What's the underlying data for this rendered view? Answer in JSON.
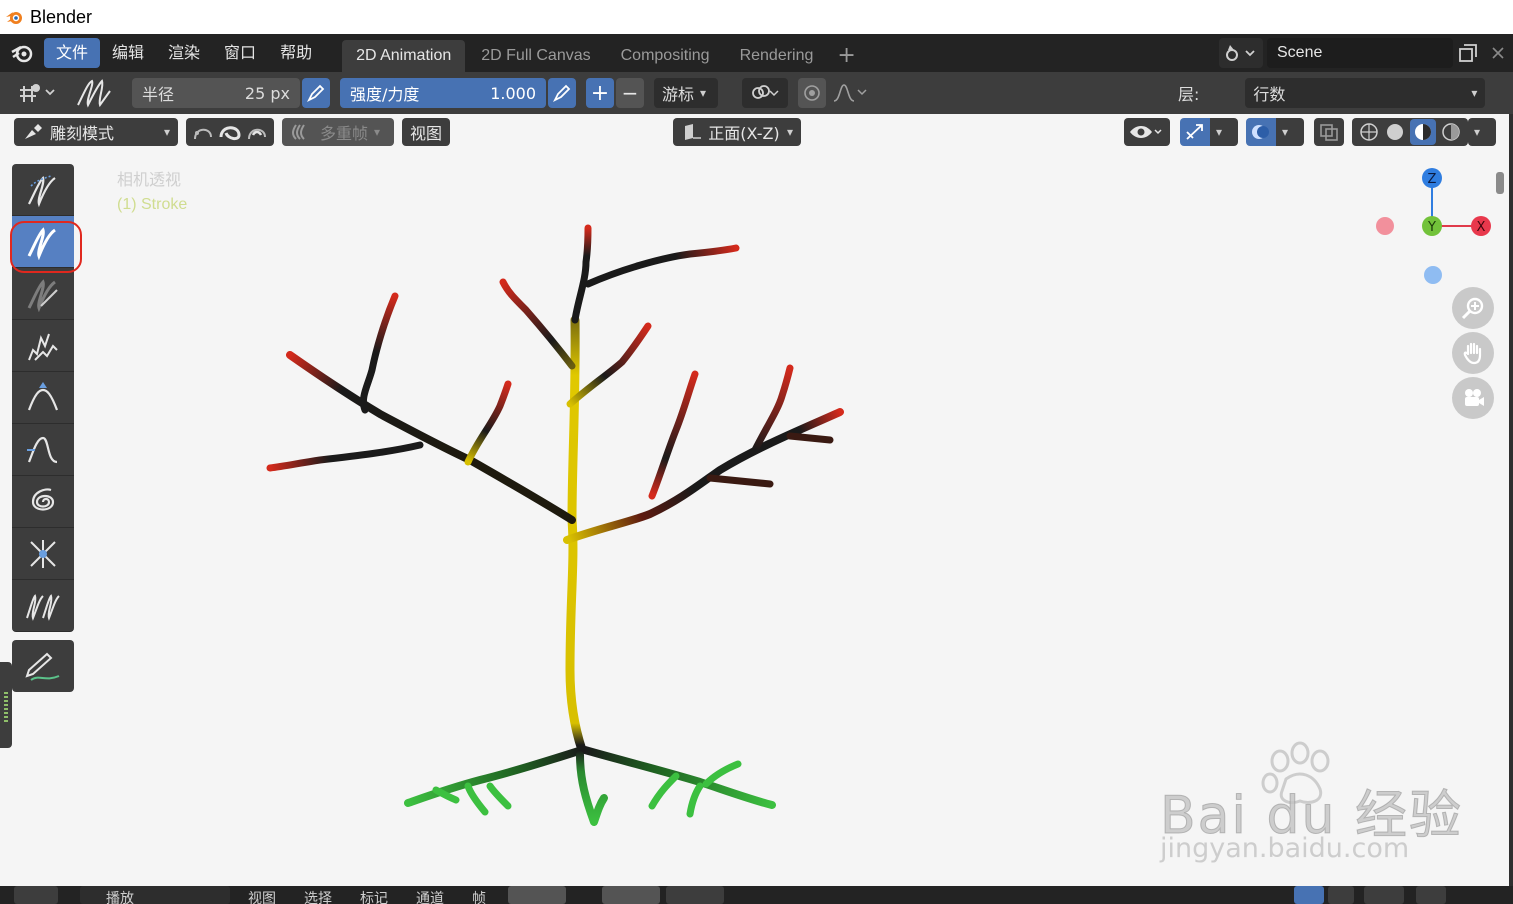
{
  "window": {
    "title": "Blender"
  },
  "topbar": {
    "menus": [
      "文件",
      "编辑",
      "渲染",
      "窗口",
      "帮助"
    ],
    "workspace_tabs": [
      "2D Animation",
      "2D Full Canvas",
      "Compositing",
      "Rendering"
    ],
    "add_tab": "+",
    "scene_name": "Scene"
  },
  "toolsettings": {
    "radius_label": "半径",
    "radius_value": "25 px",
    "strength_label": "强度/力度",
    "strength_value": "1.000",
    "plus": "+",
    "minus": "−",
    "cursor_label": "游标",
    "layer_label": "层:",
    "layer_value": "行数"
  },
  "viewport_header": {
    "mode": "雕刻模式",
    "multiframe": "多重帧",
    "view": "视图",
    "orientation": "正面(X-Z)"
  },
  "viewport": {
    "view_name": "相机透视",
    "object_name": "(1) Stroke"
  },
  "gizmo": {
    "z": "Z",
    "y": "Y",
    "x": "X"
  },
  "toolbar": {
    "tools": [
      "smooth-tool-icon",
      "thickness-tool-icon",
      "strength-tool-icon",
      "randomize-tool-icon",
      "grab-tool-icon",
      "push-tool-icon",
      "twist-tool-icon",
      "pinch-tool-icon",
      "clone-tool-icon"
    ],
    "active_index": 1,
    "annotate": "annotate-tool-icon"
  },
  "bottombar": {
    "mode": "播放",
    "items": [
      "视图",
      "选择",
      "标记",
      "通道",
      "帧"
    ]
  },
  "watermark": {
    "brand": "Bai du 经验",
    "url": "jingyan.baidu.com"
  },
  "colors": {
    "accent": "#4772b3",
    "trunk": "#e0c800",
    "branch_tip": "#d42a1c",
    "root": "#3cb83c",
    "highlight": "#e0281e"
  }
}
